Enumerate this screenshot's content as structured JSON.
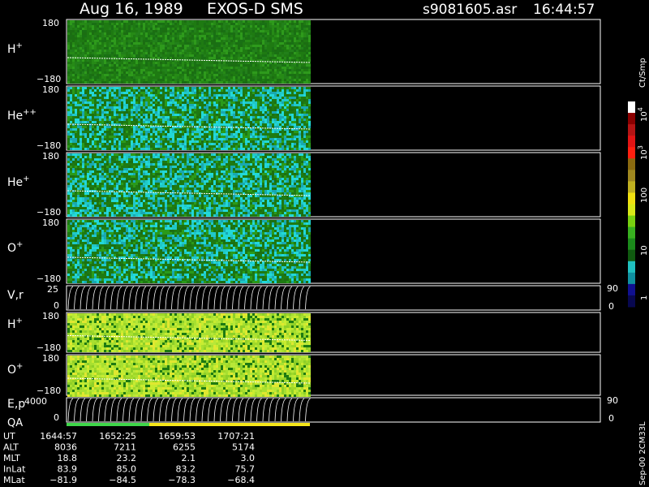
{
  "header": {
    "date": "Aug 16, 1989",
    "instrument": "EXOS-D SMS",
    "file": "s9081605.asr",
    "time": "16:44:57"
  },
  "colors": {
    "background": "#000000",
    "frame": "#ffffff",
    "panel_dark_green": "#1e7a12",
    "panel_cyan": "#20c8c8",
    "panel_yellow_green": "#a8e030",
    "qa_green": "#3fd64a",
    "qa_yellow": "#f5e61a"
  },
  "chart_data": [
    {
      "type": "heatmap",
      "species_base": "H",
      "species_sup": "+",
      "y_top": "180",
      "y_bottom": "−180",
      "ylim": [
        -180,
        180
      ],
      "palette": "green"
    },
    {
      "type": "heatmap",
      "species_base": "He",
      "species_sup": "++",
      "y_top": "180",
      "y_bottom": "−180",
      "ylim": [
        -180,
        180
      ],
      "palette": "cyan"
    },
    {
      "type": "heatmap",
      "species_base": "He",
      "species_sup": "+",
      "y_top": "180",
      "y_bottom": "−180",
      "ylim": [
        -180,
        180
      ],
      "palette": "cyan"
    },
    {
      "type": "heatmap",
      "species_base": "O",
      "species_sup": "+",
      "y_top": "180",
      "y_bottom": "−180",
      "ylim": [
        -180,
        180
      ],
      "palette": "cyan"
    },
    {
      "type": "line",
      "label": "V,r",
      "y_top": "25",
      "y_bottom": "0",
      "right_top": "90",
      "right_bottom": "0"
    },
    {
      "type": "heatmap",
      "species_base": "H",
      "species_sup": "+",
      "y_top": "180",
      "y_bottom": "−180",
      "ylim": [
        -180,
        180
      ],
      "palette": "yellow"
    },
    {
      "type": "heatmap",
      "species_base": "O",
      "species_sup": "+",
      "y_top": "180",
      "y_bottom": "−180",
      "ylim": [
        -180,
        180
      ],
      "palette": "yellow"
    },
    {
      "type": "line",
      "label": "E,p",
      "y_top": "4000",
      "y_bottom": "0",
      "right_top": "90",
      "right_bottom": "0"
    }
  ],
  "qa": {
    "label": "QA"
  },
  "colorbar": {
    "unit": "Ct/Smp",
    "labels": [
      {
        "text": "10",
        "sup": "4"
      },
      {
        "text": "10",
        "sup": "3"
      },
      {
        "text": "100",
        "sup": ""
      },
      {
        "text": "10",
        "sup": ""
      },
      {
        "text": "1",
        "sup": ""
      }
    ],
    "colors": [
      "#ffffff",
      "#8b0000",
      "#b41414",
      "#e11414",
      "#ff2010",
      "#8a6a10",
      "#a08820",
      "#c0b020",
      "#f0e010",
      "#d8e818",
      "#78d010",
      "#38b020",
      "#1b8a1b",
      "#105a10",
      "#20c0c0",
      "#1090a0",
      "#101090",
      "#080850"
    ]
  },
  "footer": {
    "rows": [
      {
        "label": "UT",
        "values": [
          "1644:57",
          "1652:25",
          "1659:53",
          "1707:21"
        ]
      },
      {
        "label": "ALT",
        "values": [
          "8036",
          "7211",
          "6255",
          "5174"
        ]
      },
      {
        "label": "MLT",
        "values": [
          "18.8",
          "23.2",
          "2.1",
          "3.0"
        ]
      },
      {
        "label": "InLat",
        "values": [
          "83.9",
          "85.0",
          "83.2",
          "75.7"
        ]
      },
      {
        "label": "MLat",
        "values": [
          "−81.9",
          "−84.5",
          "−78.3",
          "−68.4"
        ]
      }
    ],
    "creation": "Sep-00  2CM33L"
  }
}
